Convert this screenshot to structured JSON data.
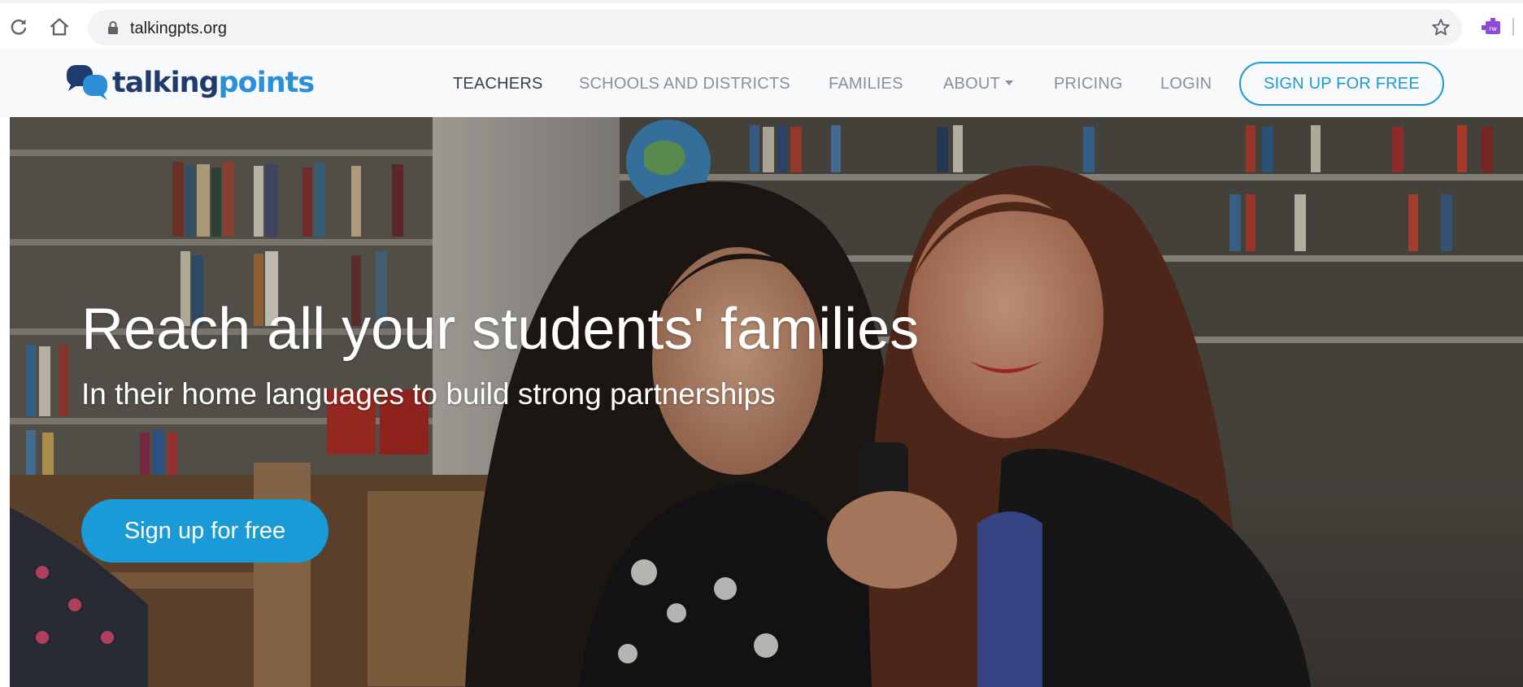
{
  "browser": {
    "url": "talkingpts.org",
    "reload_icon": "reload-icon",
    "home_icon": "home-icon",
    "lock_icon": "lock-icon",
    "bookmark_icon": "star-icon",
    "extension_icon": "extension-icon"
  },
  "brand": {
    "logo_part1": "talking",
    "logo_part2": "points",
    "colors": {
      "navy": "#1f3b6e",
      "blue": "#2a8fd6",
      "accent": "#1a9ad6"
    }
  },
  "nav": {
    "items": [
      {
        "label": "TEACHERS",
        "active": true
      },
      {
        "label": "SCHOOLS AND DISTRICTS",
        "active": false
      },
      {
        "label": "FAMILIES",
        "active": false
      },
      {
        "label": "ABOUT",
        "active": false,
        "has_dropdown": true
      },
      {
        "label": "PRICING",
        "active": false
      },
      {
        "label": "LOGIN",
        "active": false
      }
    ],
    "signup_label": "SIGN UP FOR FREE"
  },
  "hero": {
    "title": "Reach all your students' families",
    "subtitle": "In their home languages to build strong partnerships",
    "cta_label": "Sign up for free"
  }
}
